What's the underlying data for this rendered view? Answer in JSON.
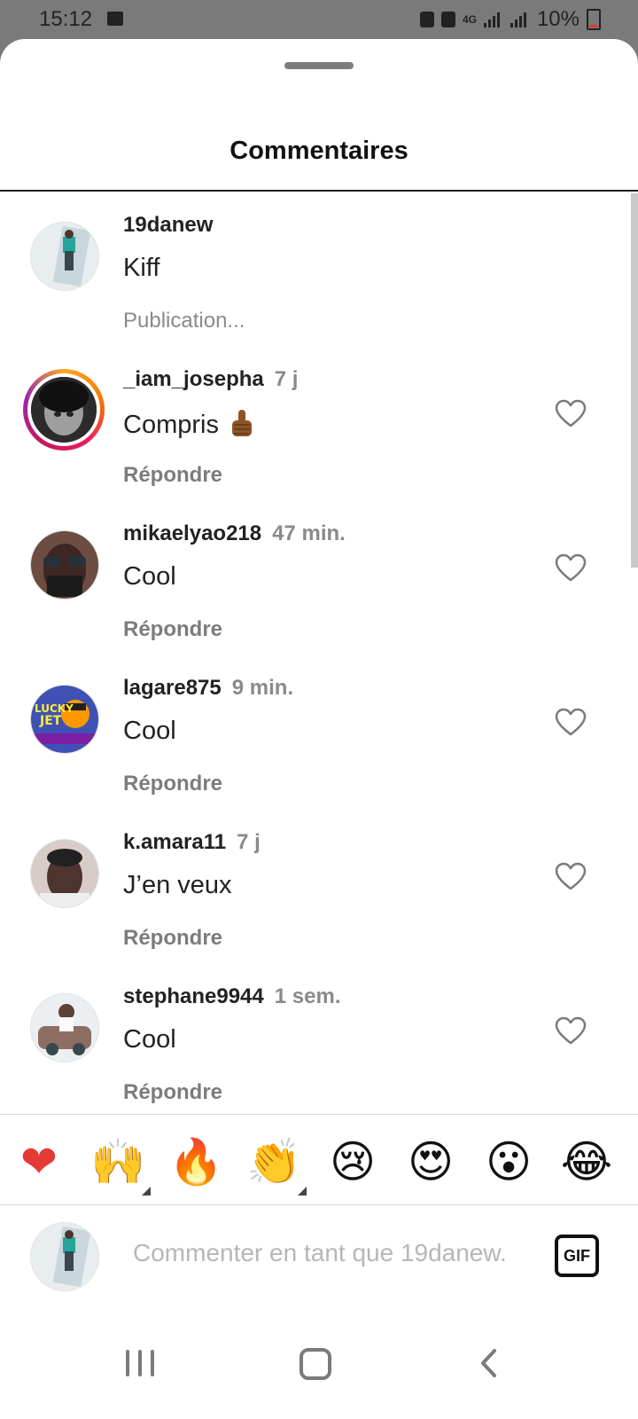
{
  "status_bar": {
    "time": "15:12",
    "battery": "10%",
    "network": "4G",
    "battery_color": "#e53935"
  },
  "sheet": {
    "title": "Commentaires"
  },
  "comments": [
    {
      "username": "19danew",
      "time": "",
      "text": "Kiff",
      "action": "Publication...",
      "avatar": "photo-outdoor",
      "liked": false
    },
    {
      "username": "_iam_josepha",
      "time": "7 j",
      "text": "Compris",
      "emoji": "thumbs-up-icon",
      "action": "Répondre",
      "avatar": "photo-bw-portrait",
      "story_ring": true
    },
    {
      "username": "mikaelyao218",
      "time": "47 min.",
      "text": "Cool",
      "action": "Répondre",
      "avatar": "photo-sunglasses"
    },
    {
      "username": "lagare875",
      "time": "9 min.",
      "text": "Cool",
      "action": "Répondre",
      "avatar": "photo-lucky-jet"
    },
    {
      "username": "k.amara11",
      "time": "7 j",
      "text": "J’en veux",
      "action": "Répondre",
      "avatar": "photo-selfie"
    },
    {
      "username": "stephane9944",
      "time": "1 sem.",
      "text": "Cool",
      "action": "Répondre",
      "avatar": "photo-car"
    }
  ],
  "reactions": [
    {
      "emoji": "❤",
      "name": "red-heart-icon"
    },
    {
      "emoji": "🙌",
      "name": "raised-hands-icon",
      "has_variants": true
    },
    {
      "emoji": "🔥",
      "name": "fire-icon"
    },
    {
      "emoji": "👏",
      "name": "clapping-hands-icon",
      "has_variants": true
    },
    {
      "emoji": "😢",
      "name": "crying-face-icon"
    },
    {
      "emoji": "😍",
      "name": "heart-eyes-icon"
    },
    {
      "emoji": "😮",
      "name": "surprised-face-icon"
    },
    {
      "emoji": "😂",
      "name": "tears-of-joy-icon"
    }
  ],
  "composer": {
    "placeholder": "Commenter en tant que 19danew.",
    "value": "",
    "gif_label": "GIF"
  },
  "colors": {
    "accent_ring": "#e91e63",
    "muted_text": "#7c7c7c",
    "placeholder": "#b6b6b6"
  }
}
